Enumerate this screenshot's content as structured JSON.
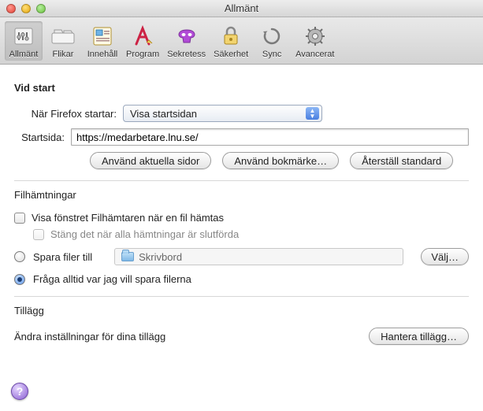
{
  "window": {
    "title": "Allmänt"
  },
  "toolbar": {
    "items": [
      {
        "label": "Allmänt",
        "selected": true
      },
      {
        "label": "Flikar",
        "selected": false
      },
      {
        "label": "Innehåll",
        "selected": false
      },
      {
        "label": "Program",
        "selected": false
      },
      {
        "label": "Sekretess",
        "selected": false
      },
      {
        "label": "Säkerhet",
        "selected": false
      },
      {
        "label": "Sync",
        "selected": false
      },
      {
        "label": "Avancerat",
        "selected": false
      }
    ]
  },
  "start": {
    "heading": "Vid start",
    "when_label": "När Firefox startar:",
    "when_value": "Visa startsidan",
    "home_label": "Startsida:",
    "home_value": "https://medarbetare.lnu.se/",
    "btn_current": "Använd aktuella sidor",
    "btn_bookmark": "Använd bokmärke…",
    "btn_restore": "Återställ standard"
  },
  "downloads": {
    "heading": "Filhämtningar",
    "show_window": "Visa fönstret Filhämtaren när en fil hämtas",
    "close_done": "Stäng det när alla hämtningar är slutförda",
    "save_to": "Spara filer till",
    "save_path": "Skrivbord",
    "choose_btn": "Välj…",
    "always_ask": "Fråga alltid var jag vill spara filerna"
  },
  "addons": {
    "heading": "Tillägg",
    "desc": "Ändra inställningar för dina tillägg",
    "manage_btn": "Hantera tillägg…"
  },
  "help_glyph": "?"
}
